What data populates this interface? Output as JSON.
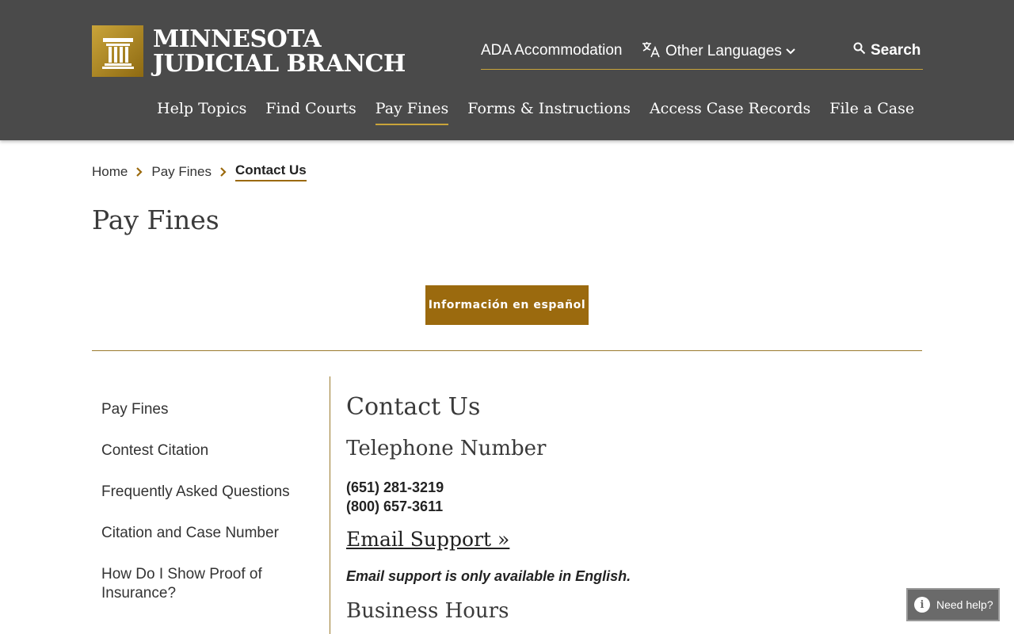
{
  "site": {
    "logo_line1": "MINNESOTA",
    "logo_line2": "JUDICIAL BRANCH",
    "logo_icon": "pillar-seal-icon",
    "brand_gold": "#9b6a0e",
    "header_bg": "#4a4a4a"
  },
  "utility_nav": {
    "ada": "ADA Accommodation",
    "languages": "Other Languages",
    "search": "Search"
  },
  "main_nav": [
    {
      "label": "Help Topics"
    },
    {
      "label": "Find Courts"
    },
    {
      "label": "Pay Fines",
      "active": true
    },
    {
      "label": "Forms & Instructions"
    },
    {
      "label": "Access Case Records"
    },
    {
      "label": "File a Case"
    }
  ],
  "breadcrumb": {
    "home": "Home",
    "section": "Pay Fines",
    "current": "Contact Us"
  },
  "page": {
    "title": "Pay Fines",
    "spanish_button": "Información en español"
  },
  "sidebar": {
    "items": [
      {
        "label": "Pay Fines"
      },
      {
        "label": "Contest Citation"
      },
      {
        "label": "Frequently Asked Questions"
      },
      {
        "label": "Citation and Case Number"
      },
      {
        "label": "How Do I Show Proof of Insurance?"
      }
    ]
  },
  "content": {
    "heading": "Contact Us",
    "phone_heading": "Telephone Number",
    "phone1": "(651) 281-3219",
    "phone2": "(800) 657-3611",
    "email_link": "Email Support »",
    "email_note": "Email support is only available in English.",
    "hours_heading": "Business Hours"
  },
  "help_widget": {
    "label": "Need help?"
  }
}
